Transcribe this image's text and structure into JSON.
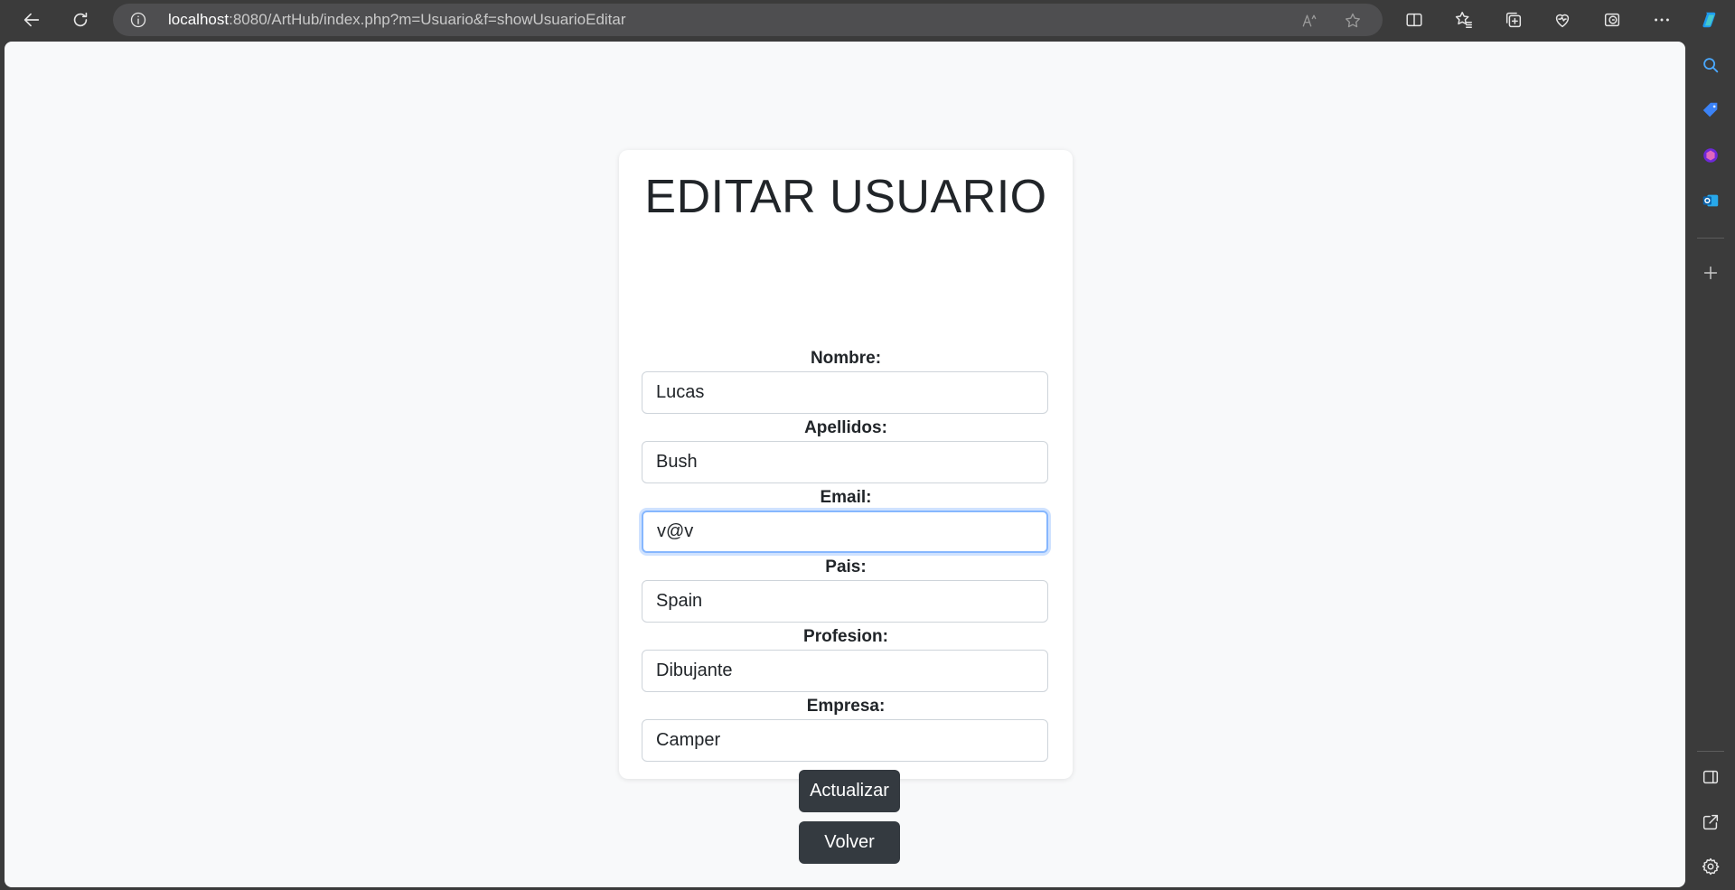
{
  "browser": {
    "url_host": "localhost",
    "url_rest": ":8080/ArtHub/index.php?m=Usuario&f=showUsuarioEditar"
  },
  "form": {
    "title": "EDITAR USUARIO",
    "fields": [
      {
        "label": "Nombre:",
        "value": "Lucas"
      },
      {
        "label": "Apellidos:",
        "value": "Bush"
      },
      {
        "label": "Email:",
        "value": "v@v"
      },
      {
        "label": "Pais:",
        "value": "Spain"
      },
      {
        "label": "Profesion:",
        "value": "Dibujante"
      },
      {
        "label": "Empresa:",
        "value": "Camper"
      }
    ],
    "update_button": "Actualizar",
    "back_button": "Volver"
  },
  "colors": {
    "page_background": "#f8f9fa",
    "card_background": "#ffffff",
    "button_dark": "#343a40",
    "focus_ring": "#86b7fe",
    "browser_chrome": "#3b3b3b"
  },
  "icons": {
    "toolbar": [
      "back-arrow-icon",
      "refresh-icon",
      "site-info-icon",
      "read-aloud-icon",
      "favorite-star-icon",
      "split-screen-icon",
      "favorites-icon",
      "collections-icon",
      "browser-essentials-icon",
      "performance-icon",
      "more-options-icon",
      "copilot-icon"
    ],
    "sidebar": [
      "search-icon",
      "shopping-tag-icon",
      "office-icon",
      "outlook-icon",
      "add-icon",
      "sidebar-toggle-icon",
      "external-link-icon",
      "settings-icon"
    ]
  }
}
